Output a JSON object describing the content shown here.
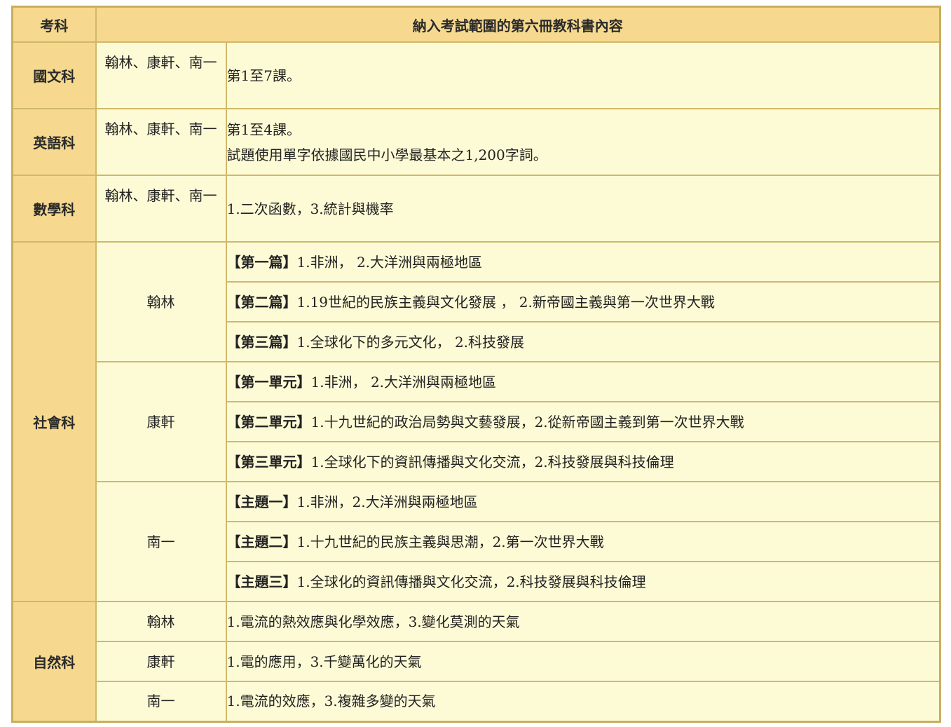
{
  "header": {
    "subject": "考科",
    "content": "納入考試範圍的第六冊教科書內容"
  },
  "chinese": {
    "subject": "國文科",
    "publishers": "翰林、康軒、南一",
    "content": "第1至7課。"
  },
  "english": {
    "subject": "英語科",
    "publishers": "翰林、康軒、南一",
    "content_1": "第1至4課。",
    "content_2": "試題使用單字依據國民中小學最基本之1,200字詞。"
  },
  "math": {
    "subject": "數學科",
    "publishers": "翰林、康軒、南一",
    "content": "1.二次函數，3.統計與機率"
  },
  "social": {
    "subject": "社會科",
    "groups": [
      {
        "publisher": "翰林",
        "rows": [
          {
            "tag": "【第一篇】",
            "text": "1.非洲， 2.大洋洲與兩極地區"
          },
          {
            "tag": "【第二篇】",
            "text": "1.19世紀的民族主義與文化發展 ， 2.新帝國主義與第一次世界大戰"
          },
          {
            "tag": "【第三篇】",
            "text": "1.全球化下的多元文化， 2.科技發展"
          }
        ]
      },
      {
        "publisher": "康軒",
        "rows": [
          {
            "tag": "【第一單元】",
            "text": "1.非洲， 2.大洋洲與兩極地區"
          },
          {
            "tag": "【第二單元】",
            "text": "1.十九世紀的政治局勢與文藝發展，2.從新帝國主義到第一次世界大戰"
          },
          {
            "tag": "【第三單元】",
            "text": "1.全球化下的資訊傳播與文化交流，2.科技發展與科技倫理"
          }
        ]
      },
      {
        "publisher": "南一",
        "rows": [
          {
            "tag": "【主題一】",
            "text": "1.非洲，2.大洋洲與兩極地區"
          },
          {
            "tag": "【主題二】",
            "text": "1.十九世紀的民族主義與思潮，2.第一次世界大戰"
          },
          {
            "tag": "【主題三】",
            "text": "1.全球化的資訊傳播與文化交流，2.科技發展與科技倫理"
          }
        ]
      }
    ]
  },
  "science": {
    "subject": "自然科",
    "rows": [
      {
        "publisher": "翰林",
        "text": "1.電流的熱效應與化學效應，3.變化莫測的天氣"
      },
      {
        "publisher": "康軒",
        "text": "1.電的應用，3.千變萬化的天氣"
      },
      {
        "publisher": "南一",
        "text": "1.電流的效應，3.複雜多變的天氣"
      }
    ]
  }
}
